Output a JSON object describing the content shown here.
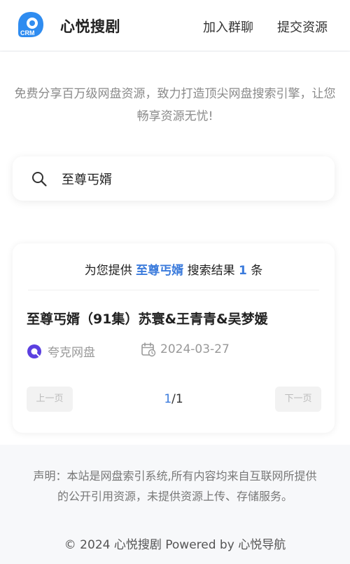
{
  "header": {
    "brand": "心悦搜剧",
    "logo_text": "CRM",
    "nav": {
      "join": "加入群聊",
      "submit": "提交资源"
    }
  },
  "hero": {
    "tagline": "免费分享百万级网盘资源，致力打造顶尖网盘搜索引擎，让您畅享资源无忧!"
  },
  "search": {
    "value": "至尊丐婿",
    "icon": "search-icon"
  },
  "results": {
    "summary_prefix": "为您提供",
    "keyword": "至尊丐婿",
    "summary_mid": "搜索结果",
    "count": "1",
    "summary_suffix": "条",
    "items": [
      {
        "title": "至尊丐婿（91集）苏寰&王青青&吴梦媛",
        "source": "夸克网盘",
        "date": "2024-03-27"
      }
    ]
  },
  "pagination": {
    "prev": "上一页",
    "next": "下一页",
    "current": "1",
    "total": "/1"
  },
  "footer": {
    "disclaimer": "声明：本站是网盘索引系统,所有内容均来自互联网所提供的公开引用资源，未提供资源上传、存储服务。",
    "copyright": "© 2024 心悦搜剧 Powered by 心悦导航"
  },
  "colors": {
    "accent": "#3b7bdc",
    "quark": "#5b3fe0"
  }
}
